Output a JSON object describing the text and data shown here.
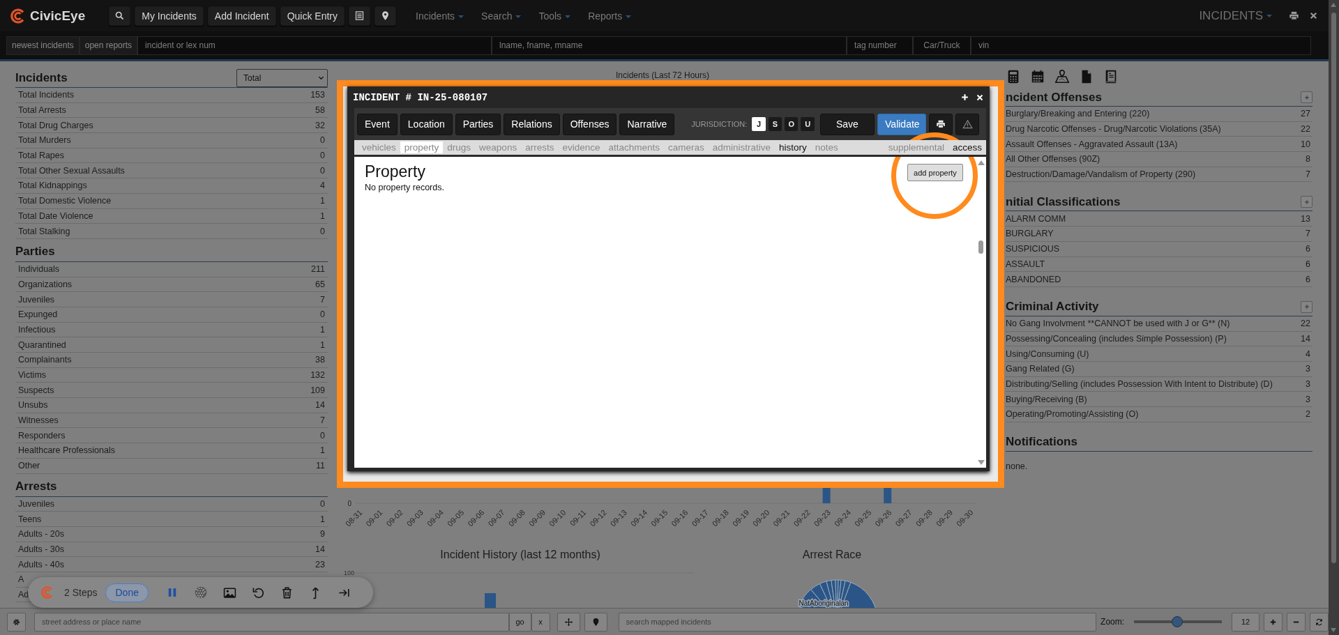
{
  "nav": {
    "brand": "CivicEye",
    "buttons": [
      "My Incidents",
      "Add Incident",
      "Quick Entry"
    ],
    "menus": [
      "Incidents",
      "Search",
      "Tools",
      "Reports"
    ],
    "module_menu": "INCIDENTS"
  },
  "search_bar": {
    "buttons": [
      "newest incidents",
      "open reports"
    ],
    "fields": [
      {
        "placeholder": "incident or lex num"
      },
      {
        "placeholder": "lname, fname, mname"
      },
      {
        "placeholder": "tag number"
      },
      {
        "placeholder": "Car/Truck"
      },
      {
        "placeholder": "vin"
      }
    ]
  },
  "stats": [
    {
      "title": "Incidents",
      "filter": "Total",
      "rows": [
        {
          "label": "Total Incidents",
          "count": "153"
        },
        {
          "label": "Total Arrests",
          "count": "58"
        },
        {
          "label": "Total Drug Charges",
          "count": "32"
        },
        {
          "label": "Total Murders",
          "count": "0"
        },
        {
          "label": "Total Rapes",
          "count": "0"
        },
        {
          "label": "Total Other Sexual Assaults",
          "count": "0"
        },
        {
          "label": "Total Kidnappings",
          "count": "4"
        },
        {
          "label": "Total Domestic Violence",
          "count": "1"
        },
        {
          "label": "Total Date Violence",
          "count": "1"
        },
        {
          "label": "Total Stalking",
          "count": "0"
        }
      ]
    },
    {
      "title": "Parties",
      "rows": [
        {
          "label": "Individuals",
          "count": "211"
        },
        {
          "label": "Organizations",
          "count": "65"
        },
        {
          "label": "Juveniles",
          "count": "7"
        },
        {
          "label": "Expunged",
          "count": "0"
        },
        {
          "label": "Infectious",
          "count": "1"
        },
        {
          "label": "Quarantined",
          "count": "1"
        },
        {
          "label": "Complainants",
          "count": "38"
        },
        {
          "label": "Victims",
          "count": "132"
        },
        {
          "label": "Suspects",
          "count": "109"
        },
        {
          "label": "Unsubs",
          "count": "14"
        },
        {
          "label": "Witnesses",
          "count": "7"
        },
        {
          "label": "Responders",
          "count": "0"
        },
        {
          "label": "Healthcare Professionals",
          "count": "1"
        },
        {
          "label": "Other",
          "count": "11"
        }
      ]
    },
    {
      "title": "Arrests",
      "rows": [
        {
          "label": "Juveniles",
          "count": "0"
        },
        {
          "label": "Teens",
          "count": "1"
        },
        {
          "label": "Adults - 20s",
          "count": "9"
        },
        {
          "label": "Adults - 30s",
          "count": "14"
        },
        {
          "label": "Adults - 40s",
          "count": "23"
        },
        {
          "label": "A"
        },
        {
          "label": "Ad"
        }
      ]
    }
  ],
  "charts": {
    "recent": {
      "title": "Incidents (Last 72 Hours)",
      "y_tick": "0",
      "x_labels": [
        "08-31",
        "09-01",
        "09-02",
        "09-03",
        "09-04",
        "09-05",
        "09-06",
        "09-07",
        "09-08",
        "09-09",
        "09-10",
        "09-11",
        "09-12",
        "09-13",
        "09-14",
        "09-15",
        "09-16",
        "09-17",
        "09-18",
        "09-19",
        "09-20",
        "09-21",
        "09-22",
        "09-23",
        "09-24",
        "09-25",
        "09-26",
        "09-27",
        "09-28",
        "09-29",
        "09-30"
      ]
    },
    "history": {
      "title": "Incident History (last 12 months)",
      "y_tick": "100"
    },
    "arrest_race": {
      "title": "Arrest Race",
      "label": "NatAboriginalan"
    }
  },
  "side_sections": [
    {
      "title": "ncident Offenses",
      "addable": true,
      "rows": [
        {
          "label": "Burglary/Breaking and Entering (220)",
          "count": "27"
        },
        {
          "label": "Drug Narcotic Offenses - Drug/Narcotic Violations (35A)",
          "count": "22"
        },
        {
          "label": "Assault Offenses - Aggravated Assault (13A)",
          "count": "10"
        },
        {
          "label": "All Other Offenses (90Z)",
          "count": "8"
        },
        {
          "label": "Destruction/Damage/Vandalism of Property (290)",
          "count": "7"
        }
      ]
    },
    {
      "title": "nitial Classifications",
      "addable": true,
      "rows": [
        {
          "label": "ALARM COMM",
          "count": "13"
        },
        {
          "label": "BURGLARY",
          "count": "7"
        },
        {
          "label": "SUSPICIOUS",
          "count": "6"
        },
        {
          "label": "ASSAULT",
          "count": "6"
        },
        {
          "label": "ABANDONED",
          "count": "6"
        }
      ]
    },
    {
      "title": "Criminal Activity",
      "addable": true,
      "rows": [
        {
          "label": "No Gang Involvment **CANNOT be used with J or G** (N)",
          "count": "22"
        },
        {
          "label": "Possessing/Concealing (includes Simple Possession) (P)",
          "count": "14"
        },
        {
          "label": "Using/Consuming (U)",
          "count": "4"
        },
        {
          "label": "Gang Related (G)",
          "count": "3"
        },
        {
          "label": "Distributing/Selling (includes Possession With Intent to Distribute) (D)",
          "count": "3"
        },
        {
          "label": "Buying/Receiving (B)",
          "count": "3"
        },
        {
          "label": "Operating/Promoting/Assisting (O)",
          "count": "2"
        }
      ]
    },
    {
      "title": "Notifications",
      "addable": false,
      "text": "none."
    }
  ],
  "modal": {
    "title": "INCIDENT # IN-25-080107",
    "sections": [
      "Event",
      "Location",
      "Parties",
      "Relations",
      "Offenses",
      "Narrative"
    ],
    "jurisdiction_label": "JURISDICTION:",
    "jurisdictions": [
      {
        "label": "J",
        "selected": true
      },
      {
        "label": "S",
        "selected": false
      },
      {
        "label": "O",
        "selected": false
      },
      {
        "label": "U",
        "selected": false
      }
    ],
    "save": "Save",
    "validate": "Validate",
    "tabs": [
      {
        "label": "vehicles",
        "selected": false,
        "has_records": false
      },
      {
        "label": "property",
        "selected": true,
        "has_records": false
      },
      {
        "label": "drugs",
        "selected": false,
        "has_records": false
      },
      {
        "label": "weapons",
        "selected": false,
        "has_records": false
      },
      {
        "label": "arrests",
        "selected": false,
        "has_records": false
      },
      {
        "label": "evidence",
        "selected": false,
        "has_records": false
      },
      {
        "label": "attachments",
        "selected": false,
        "has_records": false
      },
      {
        "label": "cameras",
        "selected": false,
        "has_records": false
      },
      {
        "label": "administrative",
        "selected": false,
        "has_records": false
      },
      {
        "label": "history",
        "selected": false,
        "has_records": true
      },
      {
        "label": "notes",
        "selected": false,
        "has_records": false
      }
    ],
    "tabs_right": [
      {
        "label": "supplemental",
        "selected": false,
        "has_records": false
      },
      {
        "label": "access",
        "selected": false,
        "has_records": true
      }
    ],
    "heading": "Property",
    "empty_text": "No property records.",
    "add_button": "add property"
  },
  "recorder": {
    "steps": "2 Steps",
    "done": "Done"
  },
  "footer": {
    "address_placeholder": "street address or place name",
    "go": "go",
    "clear": "x",
    "map_search_placeholder": "search mapped incidents",
    "zoom_label": "Zoom:",
    "zoom": {
      "level": 0.49
    },
    "zoom_value": "12"
  }
}
